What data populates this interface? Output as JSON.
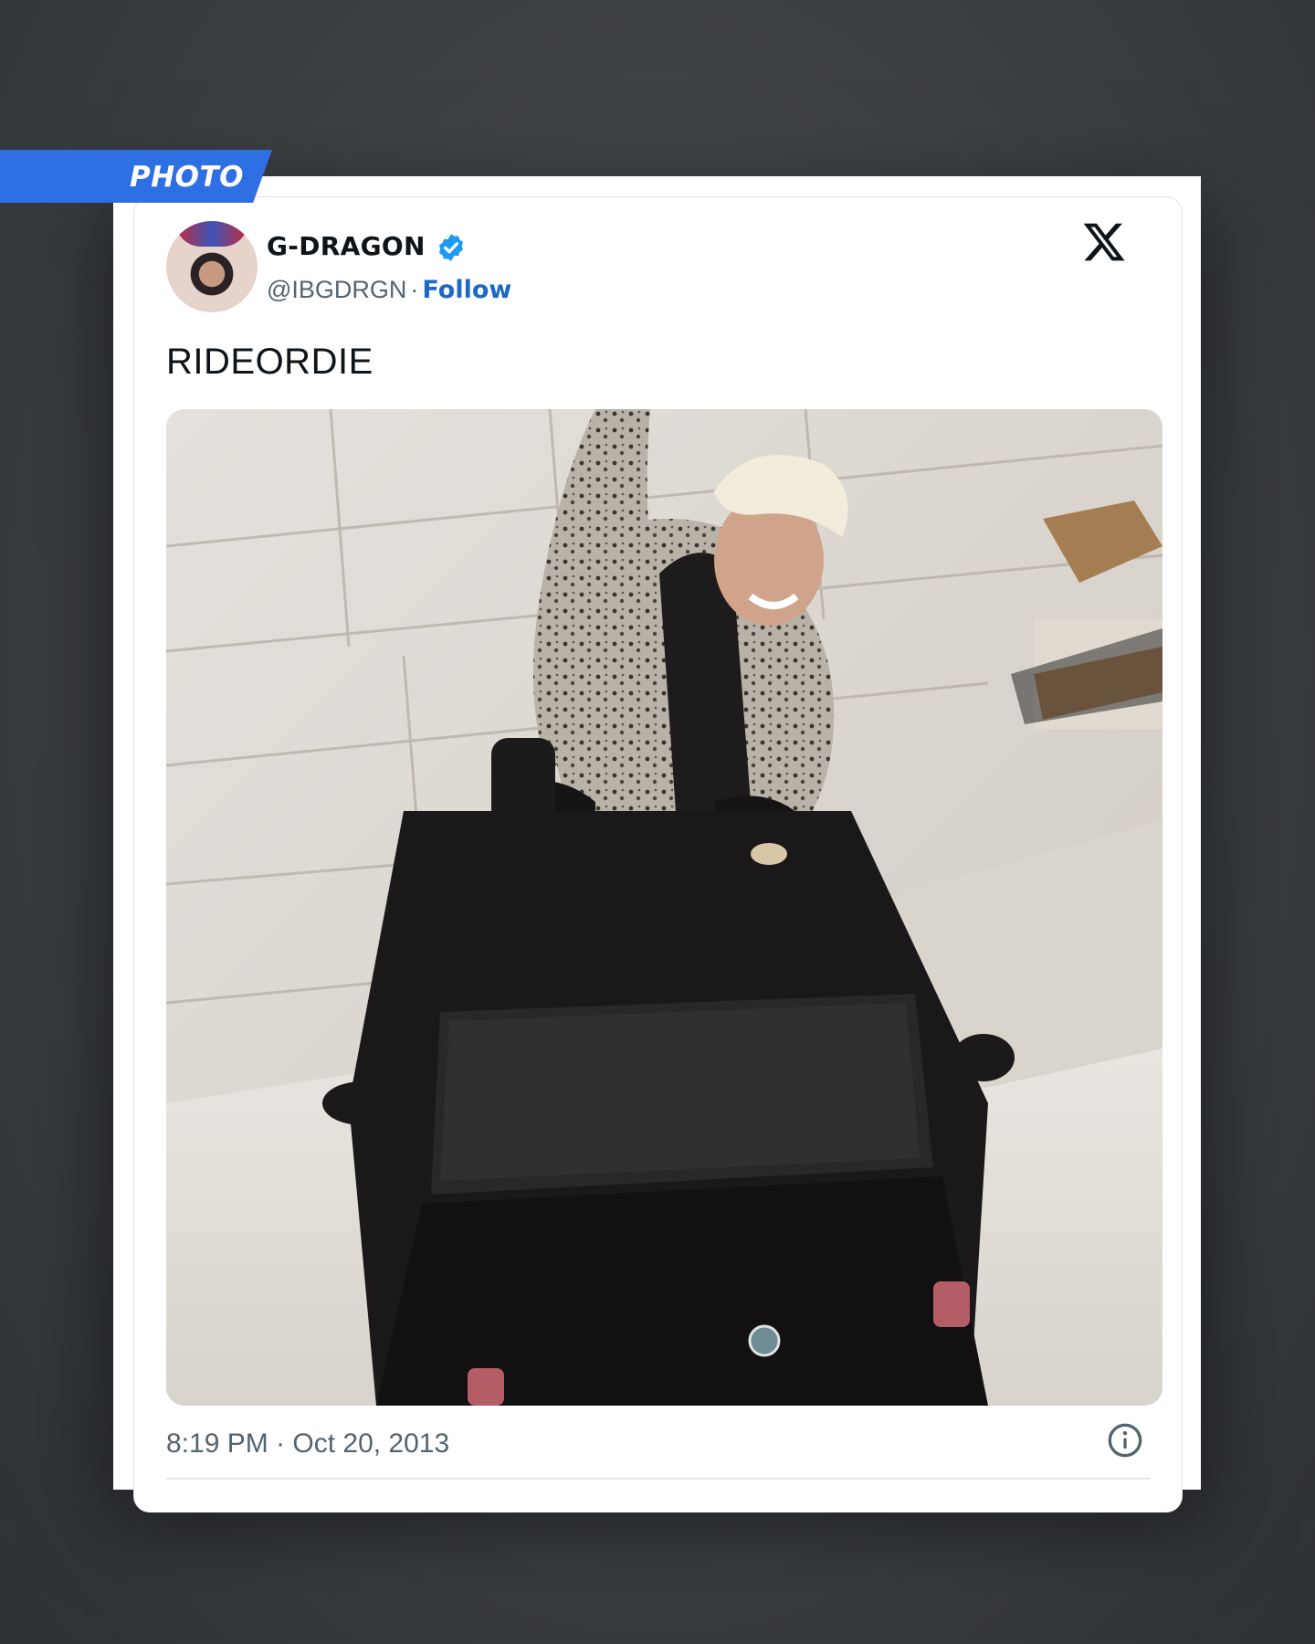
{
  "badge": {
    "label": "PHOTO"
  },
  "tweet": {
    "display_name": "G-DRAGON",
    "handle": "@IBGDRGN",
    "separator": "·",
    "follow_label": "Follow",
    "text": "RIDEORDIE",
    "timestamp": "8:19 PM · Oct 20, 2013",
    "verified": true
  },
  "icons": {
    "verified": "verified-badge-icon",
    "platform": "x-logo-icon",
    "info": "info-icon"
  },
  "colors": {
    "badge_blue": "#2f6fe4",
    "follow_blue": "#1d68c7",
    "verified_blue": "#1d9bf0",
    "text_dark": "#0f1419",
    "text_muted": "#536471"
  }
}
